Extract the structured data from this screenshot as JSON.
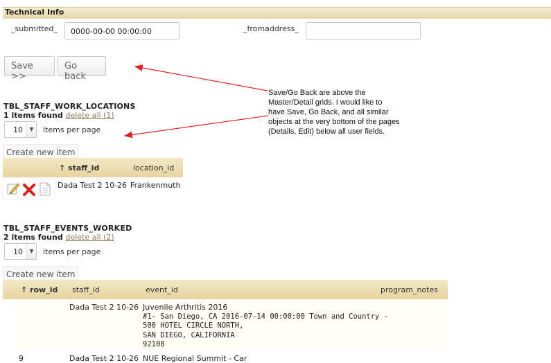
{
  "technical_info": {
    "title": "Technical Info",
    "submitted_label": "_submitted_",
    "submitted_value": "0000-00-00 00:00:00",
    "fromaddress_label": "_fromaddress_",
    "fromaddress_value": ""
  },
  "actions": {
    "save_label": "Save >>",
    "goback_label": "Go back"
  },
  "callout": {
    "lines": [
      "Save/Go Back are  above the",
      "Master/Detail grids. I would like to",
      "have Save, Go Back, and all similar",
      "objects at the very bottom of the pages",
      "(Details, Edit) below all user fields."
    ],
    "arrow_color": "#e02020"
  },
  "grid1": {
    "title": "TBL_STAFF_WORK_LOCATIONS",
    "found": "1 items found",
    "delete_all": "delete all (1)",
    "per_page_value": "10",
    "per_page_label": "items per page",
    "create_label": "Create new item",
    "columns": [
      "↑ staff_id",
      "location_id"
    ],
    "rows": [
      {
        "staff_id": "Dada Test 2 10-26",
        "location_id": "Frankenmuth"
      }
    ]
  },
  "grid2": {
    "title": "TBL_STAFF_EVENTS_WORKED",
    "found": "2 items found",
    "delete_all": "delete all (2)",
    "per_page_value": "10",
    "per_page_label": "items per page",
    "create_label": "Create new item",
    "columns": [
      "↑ row_id",
      "staff_id",
      "event_id",
      "program_notes"
    ],
    "rows": [
      {
        "row_id": "",
        "staff_id": "Dada Test 2 10-26",
        "event_lines": [
          "Juvenile Arthritis 2016",
          "#1- San Diego, CA 2016-07-14 00:00:00 Town and Country -",
          "500 HOTEL CIRCLE NORTH,",
          "SAN DIEGO, CALIFORNIA",
          "92108"
        ]
      },
      {
        "row_id": "9",
        "staff_id": "Dada Test 2 10-26",
        "event_lines": [
          "NUE Regional Summit - Car"
        ]
      }
    ]
  },
  "colors": {
    "header_gold": "#e7d8a8",
    "link": "#8a7a55"
  }
}
